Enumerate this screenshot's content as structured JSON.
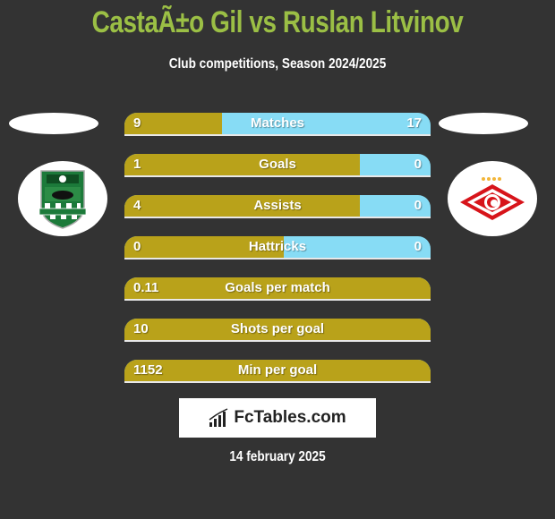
{
  "header": {
    "title": "CastaÃ±o Gil vs Ruslan Litvinov",
    "subtitle": "Club competitions, Season 2024/2025"
  },
  "colors": {
    "background": "#333333",
    "title": "#9bbf45",
    "left_bar": "#b9a21a",
    "right_bar": "#87dcf5"
  },
  "left_team": {
    "logo_icon": "krasnodar-crest-icon"
  },
  "right_team": {
    "logo_icon": "spartak-crest-icon"
  },
  "stats": [
    {
      "label": "Matches",
      "left": "9",
      "right": "17",
      "left_share": 0.32
    },
    {
      "label": "Goals",
      "left": "1",
      "right": "0",
      "left_share": 0.77
    },
    {
      "label": "Assists",
      "left": "4",
      "right": "0",
      "left_share": 0.77
    },
    {
      "label": "Hattricks",
      "left": "0",
      "right": "0",
      "left_share": 0.52
    },
    {
      "label": "Goals per match",
      "left": "0.11",
      "right": "",
      "left_share": 1.0
    },
    {
      "label": "Shots per goal",
      "left": "10",
      "right": "",
      "left_share": 1.0
    },
    {
      "label": "Min per goal",
      "left": "1152",
      "right": "",
      "left_share": 1.0
    }
  ],
  "footer": {
    "brand": "FcTables.com",
    "brand_icon": "bar-chart-icon",
    "date": "14 february 2025"
  }
}
